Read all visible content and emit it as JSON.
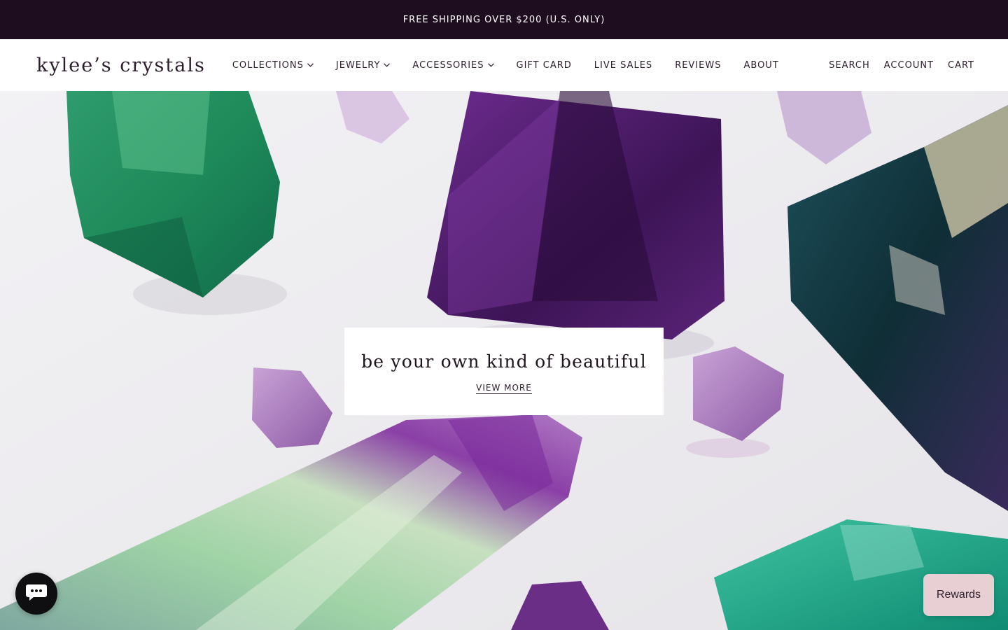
{
  "announcement": {
    "text": "FREE SHIPPING OVER $200 (U.S. ONLY)"
  },
  "header": {
    "logo": "kylee’s crystals",
    "nav": [
      {
        "label": "COLLECTIONS",
        "has_dropdown": true
      },
      {
        "label": "JEWELRY",
        "has_dropdown": true
      },
      {
        "label": "ACCESSORIES",
        "has_dropdown": true
      },
      {
        "label": "GIFT CARD",
        "has_dropdown": false
      },
      {
        "label": "LIVE SALES",
        "has_dropdown": false
      },
      {
        "label": "REVIEWS",
        "has_dropdown": false
      },
      {
        "label": "ABOUT",
        "has_dropdown": false
      }
    ],
    "utilities": {
      "search": "SEARCH",
      "account": "ACCOUNT",
      "cart": "CART"
    }
  },
  "hero": {
    "headline": "be your own kind of beautiful",
    "cta": "VIEW MORE"
  },
  "widgets": {
    "chat_icon": "chat-bubble-icon",
    "rewards": "Rewards"
  },
  "colors": {
    "announcement_bg": "#1e0d1e",
    "text": "#2b1d2b",
    "rewards_bg": "#e8cfd4",
    "chat_bg": "#0f0f12"
  }
}
